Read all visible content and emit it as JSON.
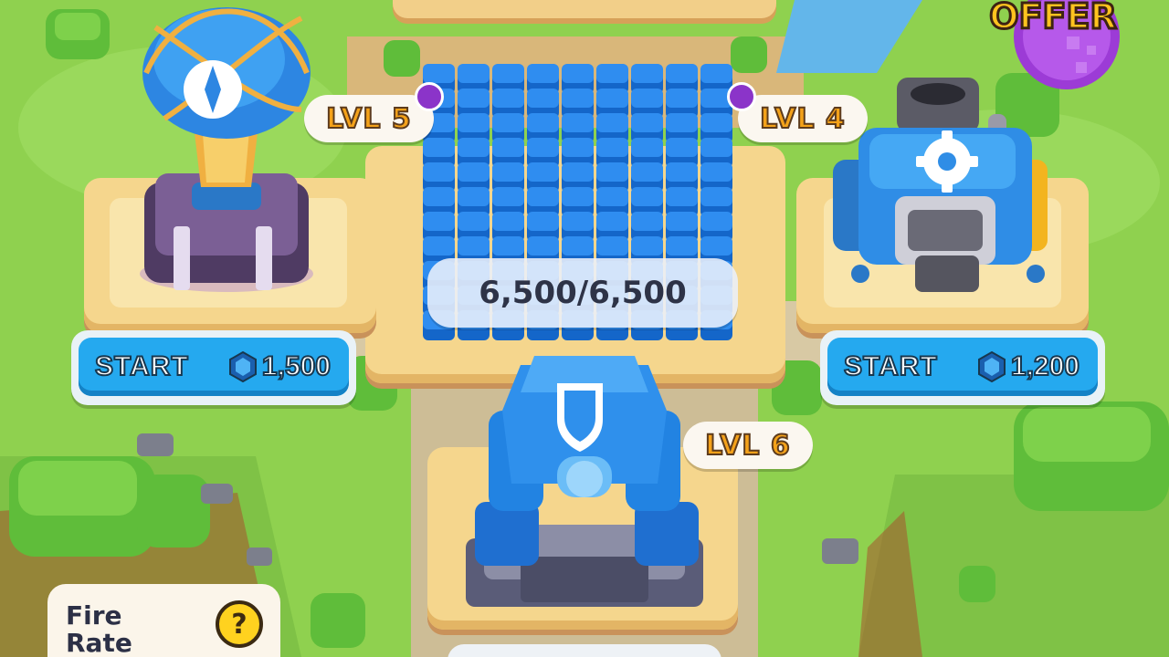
{
  "offer": {
    "label": "OFFER"
  },
  "buildings": {
    "radar": {
      "level": "LVL 5",
      "start_label": "START",
      "cost": "1,500"
    },
    "storage": {
      "level": "LVL 4",
      "capacity": "6,500/6,500"
    },
    "factory": {
      "level": "LVL 4",
      "start_label": "START",
      "cost": "1,200"
    },
    "turret": {
      "level": "LVL 6"
    }
  },
  "info_panel": {
    "title_line1": "Fire",
    "title_line2": "Rate",
    "help_symbol": "?"
  },
  "colors": {
    "button_blue": "#25a9ef",
    "level_orange": "#f4a21a",
    "grass": "#8fd14f",
    "plate": "#f5d68d",
    "purple_dot": "#8b34c9"
  },
  "icons": [
    "compass-icon",
    "gear-icon",
    "shield-icon",
    "currency-hex-icon",
    "help-icon"
  ]
}
